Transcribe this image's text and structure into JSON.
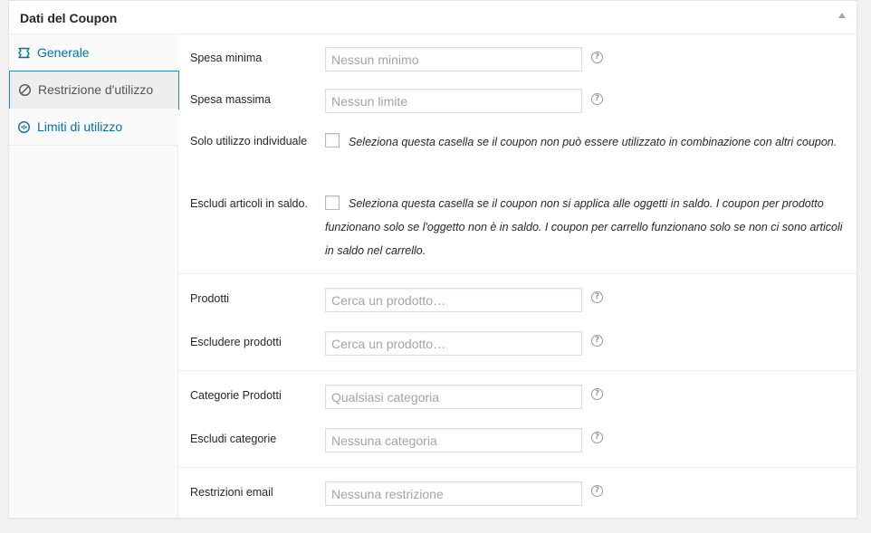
{
  "metabox": {
    "title": "Dati del Coupon"
  },
  "tabs": [
    {
      "label": "Generale",
      "icon": "ticket-icon",
      "active": false
    },
    {
      "label": "Restrizione d'utilizzo",
      "icon": "block-icon",
      "active": true
    },
    {
      "label": "Limiti di utilizzo",
      "icon": "limits-icon",
      "active": false
    }
  ],
  "fields": {
    "minimum_spend": {
      "label": "Spesa minima",
      "placeholder": "Nessun minimo",
      "value": ""
    },
    "maximum_spend": {
      "label": "Spesa massima",
      "placeholder": "Nessun limite",
      "value": ""
    },
    "individual_use": {
      "label": "Solo utilizzo individuale",
      "checked": false,
      "description": "Seleziona questa casella se il coupon non può essere utilizzato in combinazione con altri coupon."
    },
    "exclude_sale_items": {
      "label": "Escludi articoli in saldo.",
      "checked": false,
      "description": "Seleziona questa casella se il coupon non si applica alle oggetti in saldo. I coupon per prodotto funzionano solo se l'oggetto non è in saldo. I coupon per carrello funzionano solo se non ci sono articoli in saldo nel carrello."
    },
    "products": {
      "label": "Prodotti",
      "placeholder": "Cerca un prodotto…",
      "value": ""
    },
    "exclude_products": {
      "label": "Escludere prodotti",
      "placeholder": "Cerca un prodotto…",
      "value": ""
    },
    "product_categories": {
      "label": "Categorie Prodotti",
      "placeholder": "Qualsiasi categoria",
      "value": ""
    },
    "exclude_categories": {
      "label": "Escludi categorie",
      "placeholder": "Nessuna categoria",
      "value": ""
    },
    "email_restrictions": {
      "label": "Restrizioni email",
      "placeholder": "Nessuna restrizione",
      "value": ""
    }
  },
  "help_icon_glyph": "?",
  "colors": {
    "link": "#0073aa",
    "active_tab_border": "#2c86c5",
    "placeholder": "#a0a5aa"
  }
}
